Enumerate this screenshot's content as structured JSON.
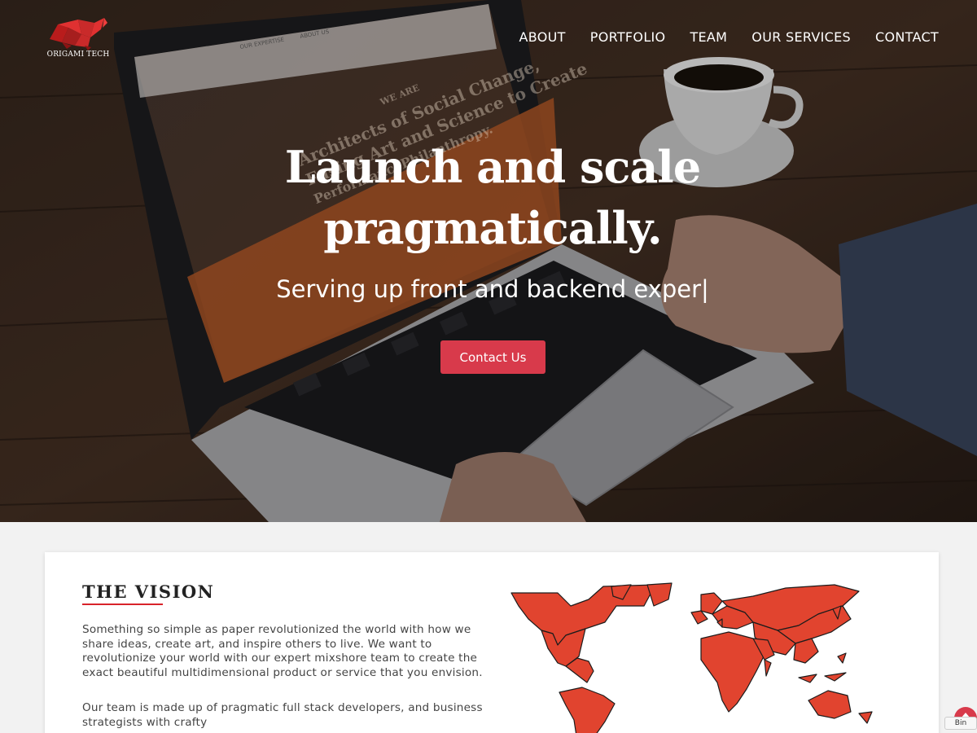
{
  "brand": {
    "name": "ORIGAMI TECH",
    "accent": "#d8232a"
  },
  "nav": [
    {
      "label": "ABOUT"
    },
    {
      "label": "PORTFOLIO"
    },
    {
      "label": "TEAM"
    },
    {
      "label": "OUR SERVICES"
    },
    {
      "label": "CONTACT"
    }
  ],
  "hero": {
    "headline_line1": "Launch and scale",
    "headline_line2": "pragmatically.",
    "subline": "Serving up front and backend exper|",
    "cta_label": "Contact Us",
    "cta_color": "#d83a4b",
    "laptop_screen": {
      "nav1": "OUR EXPERTISE",
      "nav2": "ABOUT US",
      "small": "WE ARE",
      "line1": "Architects of Social Change,",
      "line2": "Fusing Art and Science to Create",
      "line3": "PerformancePhilanthropy."
    }
  },
  "vision": {
    "title": "THE VISION",
    "paragraph1": "Something so simple as paper revolutionized the world with how we share ideas, create art, and inspire others to live. We want to revolutionize your world with our expert mixshore team to create the exact beautiful multidimensional product or service that you envision.",
    "paragraph2": "Our team is made up of pragmatic full stack developers, and business strategists with crafty"
  },
  "widget": {
    "label": "Bin"
  }
}
